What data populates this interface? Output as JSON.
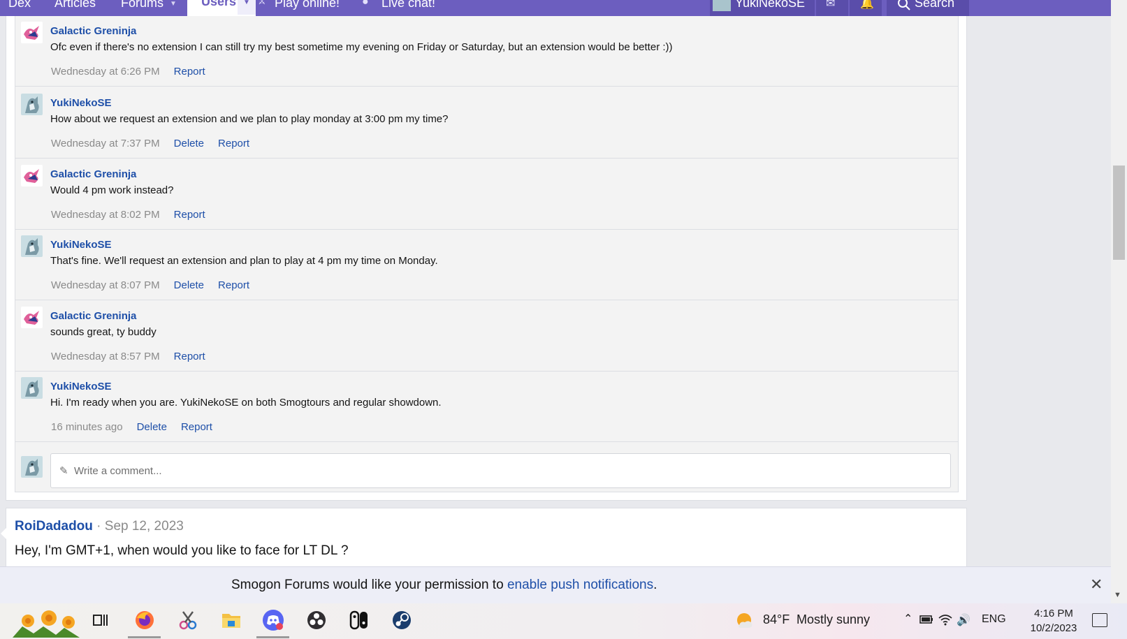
{
  "nav": {
    "items": [
      "Dex",
      "Articles",
      "Forums",
      "Users",
      "Play online!",
      "Live chat!"
    ],
    "user": "YukiNekoSE",
    "search": "Search"
  },
  "comments": [
    {
      "author": "Galactic Greninja",
      "avatar": "greninja",
      "text": "Ofc even if there's no extension I can still try my best sometime my evening on Friday or Saturday, but an extension would be better :))",
      "time": "Wednesday at 6:26 PM",
      "actions": [
        "Report"
      ]
    },
    {
      "author": "YukiNekoSE",
      "avatar": "yuki",
      "text": "How about we request an extension and we plan to play monday at 3:00 pm my time?",
      "time": "Wednesday at 7:37 PM",
      "actions": [
        "Delete",
        "Report"
      ]
    },
    {
      "author": "Galactic Greninja",
      "avatar": "greninja",
      "text": "Would 4 pm work instead?",
      "time": "Wednesday at 8:02 PM",
      "actions": [
        "Report"
      ]
    },
    {
      "author": "YukiNekoSE",
      "avatar": "yuki",
      "text": "That's fine. We'll request an extension and plan to play at 4 pm my time on Monday.",
      "time": "Wednesday at 8:07 PM",
      "actions": [
        "Delete",
        "Report"
      ]
    },
    {
      "author": "Galactic Greninja",
      "avatar": "greninja",
      "text": "sounds great, ty buddy",
      "time": "Wednesday at 8:57 PM",
      "actions": [
        "Report"
      ]
    },
    {
      "author": "YukiNekoSE",
      "avatar": "yuki",
      "text": "Hi. I'm ready when you are. YukiNekoSE on both Smogtours and regular showdown.",
      "time": "16 minutes ago",
      "actions": [
        "Delete",
        "Report"
      ]
    }
  ],
  "reply": {
    "placeholder": "Write a comment..."
  },
  "next_message": {
    "author": "RoiDadadou",
    "separator": "·",
    "date": "Sep 12, 2023",
    "text": "Hey, I'm GMT+1, when would you like to face for LT DL ?"
  },
  "push_notice": {
    "text_before": "Smogon Forums would like your permission to ",
    "link": "enable push notifications",
    "text_after": ".",
    "close": "✕"
  },
  "taskbar": {
    "apps": [
      "task-view",
      "firefox",
      "snipping-tool",
      "file-explorer",
      "discord",
      "obs",
      "switch",
      "steam"
    ],
    "weather_temp": "84°F",
    "weather_text": "Mostly sunny",
    "language": "ENG",
    "time": "4:16 PM",
    "date": "10/2/2023"
  },
  "colors": {
    "nav": "#6c5ebf",
    "link": "#1e4fa8",
    "muted": "#8a8a8a"
  }
}
